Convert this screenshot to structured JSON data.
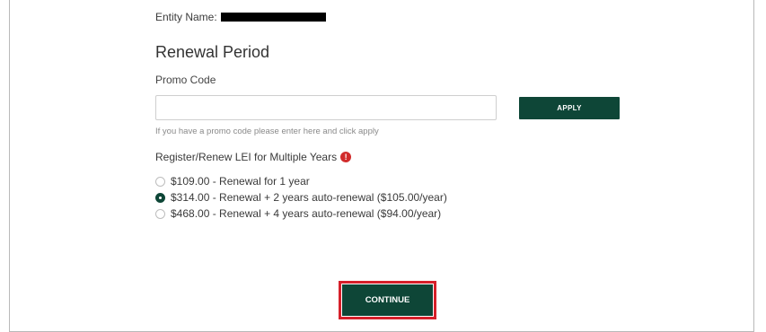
{
  "entity": {
    "label": "Entity Name:"
  },
  "section_title": "Renewal Period",
  "promo": {
    "label": "Promo Code",
    "value": "",
    "placeholder": "",
    "help": "If you have a promo code please enter here and click apply",
    "apply_label": "APPLY"
  },
  "multi_year": {
    "label": "Register/Renew LEI for Multiple Years",
    "alert_icon": "exclamation-circle-icon",
    "alert_color": "#d12b2b",
    "options": [
      {
        "label": "$109.00 - Renewal for 1 year",
        "selected": false
      },
      {
        "label": "$314.00 - Renewal + 2 years auto-renewal ($105.00/year)",
        "selected": true
      },
      {
        "label": "$468.00 - Renewal + 4 years auto-renewal ($94.00/year)",
        "selected": false
      }
    ]
  },
  "continue_label": "CONTINUE",
  "colors": {
    "primary_button": "#0e4637",
    "highlight_border": "#d6202a"
  }
}
